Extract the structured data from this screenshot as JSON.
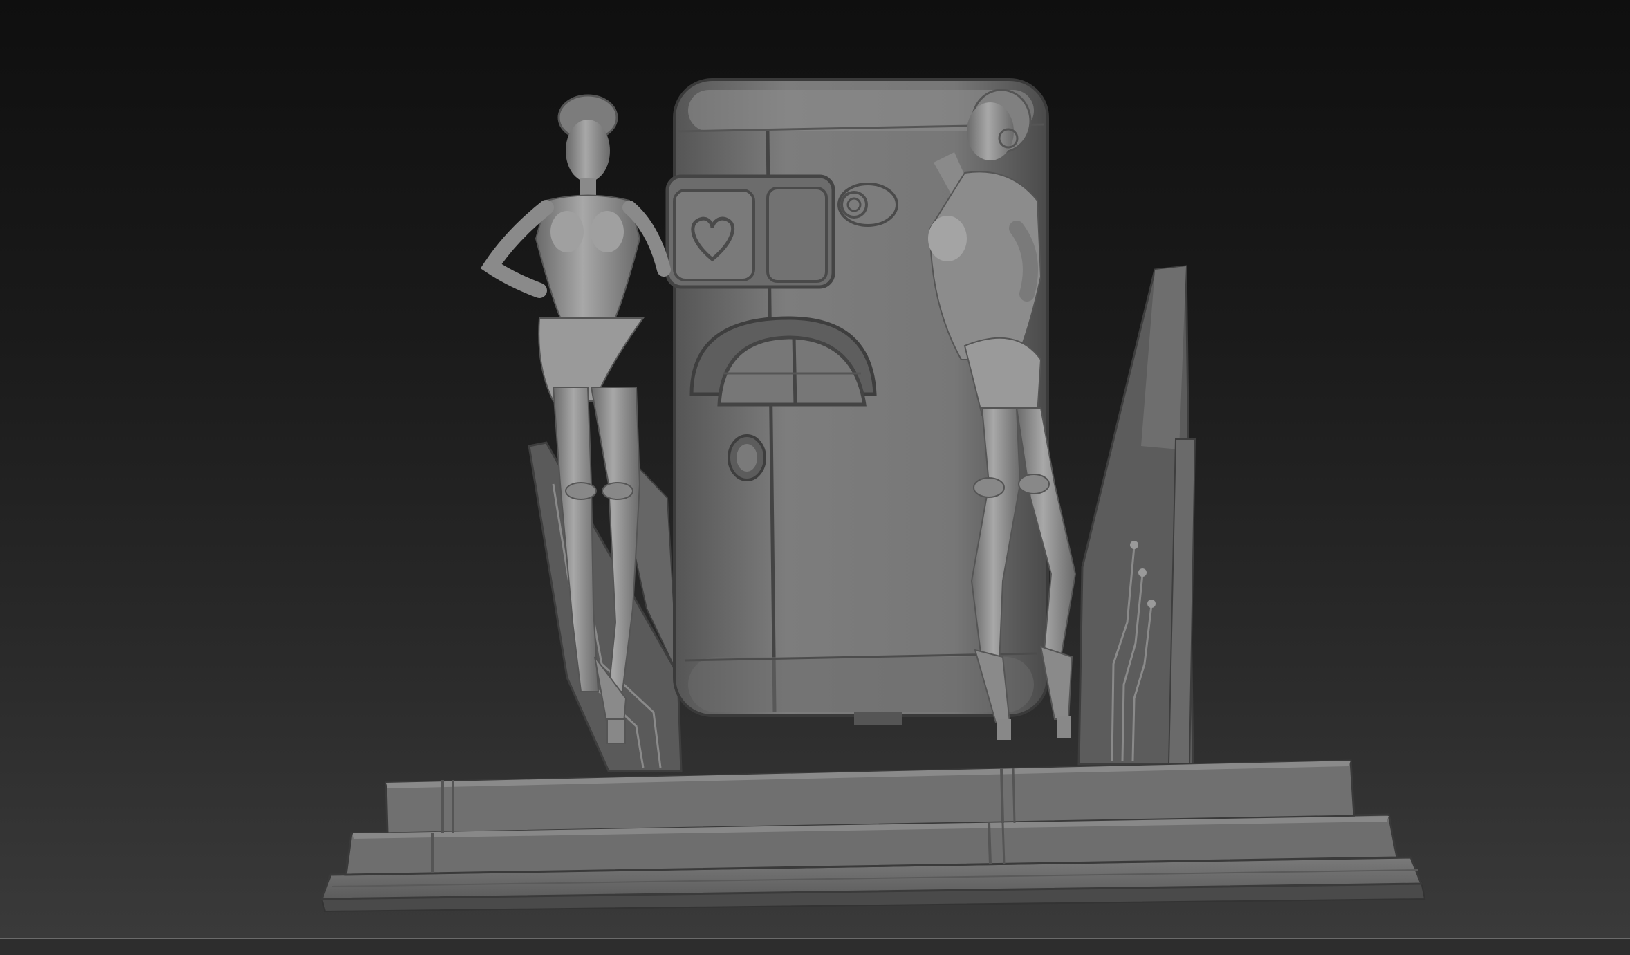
{
  "viewport": {
    "background_top": "#0f0f0f",
    "background_bottom": "#3a3a3a",
    "material_color": "#7a7a7a"
  },
  "scene": {
    "objects": [
      "figure-left",
      "figure-right",
      "vending-machine",
      "heart-icon",
      "pedestal-base",
      "back-panel-left",
      "back-panel-right"
    ]
  }
}
